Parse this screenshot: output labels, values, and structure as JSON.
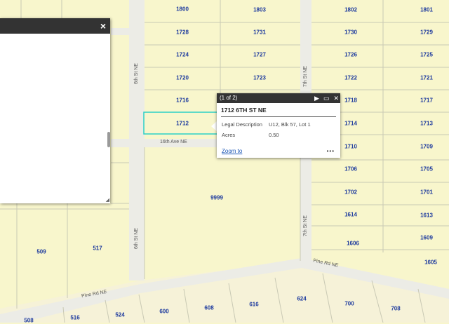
{
  "map": {
    "parcels": [
      "1800",
      "1803",
      "1802",
      "1801",
      "1728",
      "1731",
      "1730",
      "1729",
      "1724",
      "1727",
      "1726",
      "1725",
      "1720",
      "1723",
      "1722",
      "1721",
      "1716",
      "1718",
      "1717",
      "1712",
      "1714",
      "1713",
      "1710",
      "1709",
      "1706",
      "1705",
      "1702",
      "1701",
      "1614",
      "1613",
      "1609",
      "1606",
      "1605",
      "9999",
      "509",
      "517",
      "508",
      "516",
      "524",
      "600",
      "608",
      "616",
      "624",
      "700",
      "708"
    ],
    "streets": {
      "sixth_upper": "6th St NE",
      "sixth_lower": "6th St NE",
      "seventh_upper": "7th St NE",
      "seventh_lower": "7th St NE",
      "sixteenth": "16th Ave NE",
      "pine_left": "Pine Rd NE",
      "pine_right": "Pine Rd NE"
    },
    "colors": {
      "parcel_fill": "#f8f6cc",
      "parcel_line": "#c9c9b4",
      "road": "#ecece6",
      "label": "#1d3a9e",
      "highlight": "#2bd0c6",
      "lower_parcels": "#f6f2d8"
    }
  },
  "side_panel": {
    "close_icon": "×"
  },
  "popup": {
    "counter": "(1 of 2)",
    "title": "1712 6TH ST NE",
    "attributes": [
      {
        "key": "Legal Description",
        "value": "U12, Blk 57, Lot 1"
      },
      {
        "key": "Acres",
        "value": "0.50"
      }
    ],
    "zoom_label": "Zoom to",
    "more_label": "•••",
    "next_icon": "▶",
    "maximize_icon": "▭",
    "close_icon": "✕"
  }
}
